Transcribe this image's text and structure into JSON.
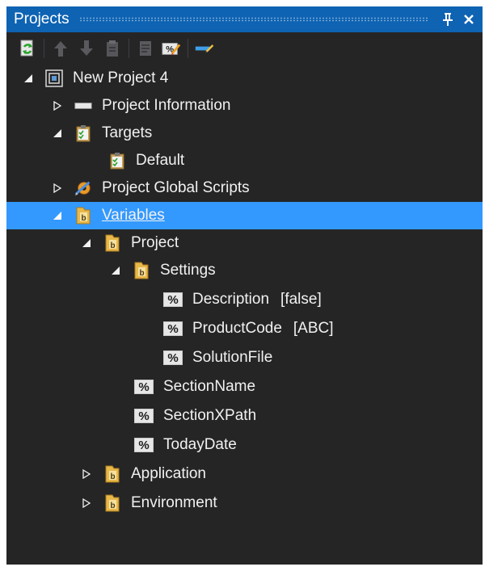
{
  "panel": {
    "title": "Projects",
    "pin_glyph": "📌",
    "close_glyph": "✕"
  },
  "toolbar": {
    "buttons": [
      {
        "name": "refresh-icon",
        "enabled": true
      },
      {
        "name": "move-up-icon",
        "enabled": false
      },
      {
        "name": "move-down-icon",
        "enabled": false
      },
      {
        "name": "clipboard-icon",
        "enabled": false
      },
      {
        "name": "script-icon",
        "enabled": false
      },
      {
        "name": "variable-edit-icon",
        "enabled": true
      },
      {
        "name": "rename-icon",
        "enabled": true
      }
    ]
  },
  "tree": {
    "project": "New Project 4",
    "project_information": "Project Information",
    "targets": "Targets",
    "targets_default": "Default",
    "global_scripts": "Project Global Scripts",
    "variables": "Variables",
    "var_project": "Project",
    "settings": "Settings",
    "description": {
      "name": "Description",
      "value": "[false]"
    },
    "product_code": {
      "name": "ProductCode",
      "value": "[ABC]"
    },
    "solution_file": {
      "name": "SolutionFile"
    },
    "section_name": "SectionName",
    "section_xpath": "SectionXPath",
    "today_date": "TodayDate",
    "application": "Application",
    "environment": "Environment"
  },
  "percent_glyph": "%",
  "colors": {
    "title_bar": "#0e63b3",
    "background": "#252526",
    "selection": "#3399ff",
    "text": "#f1f1f1"
  }
}
